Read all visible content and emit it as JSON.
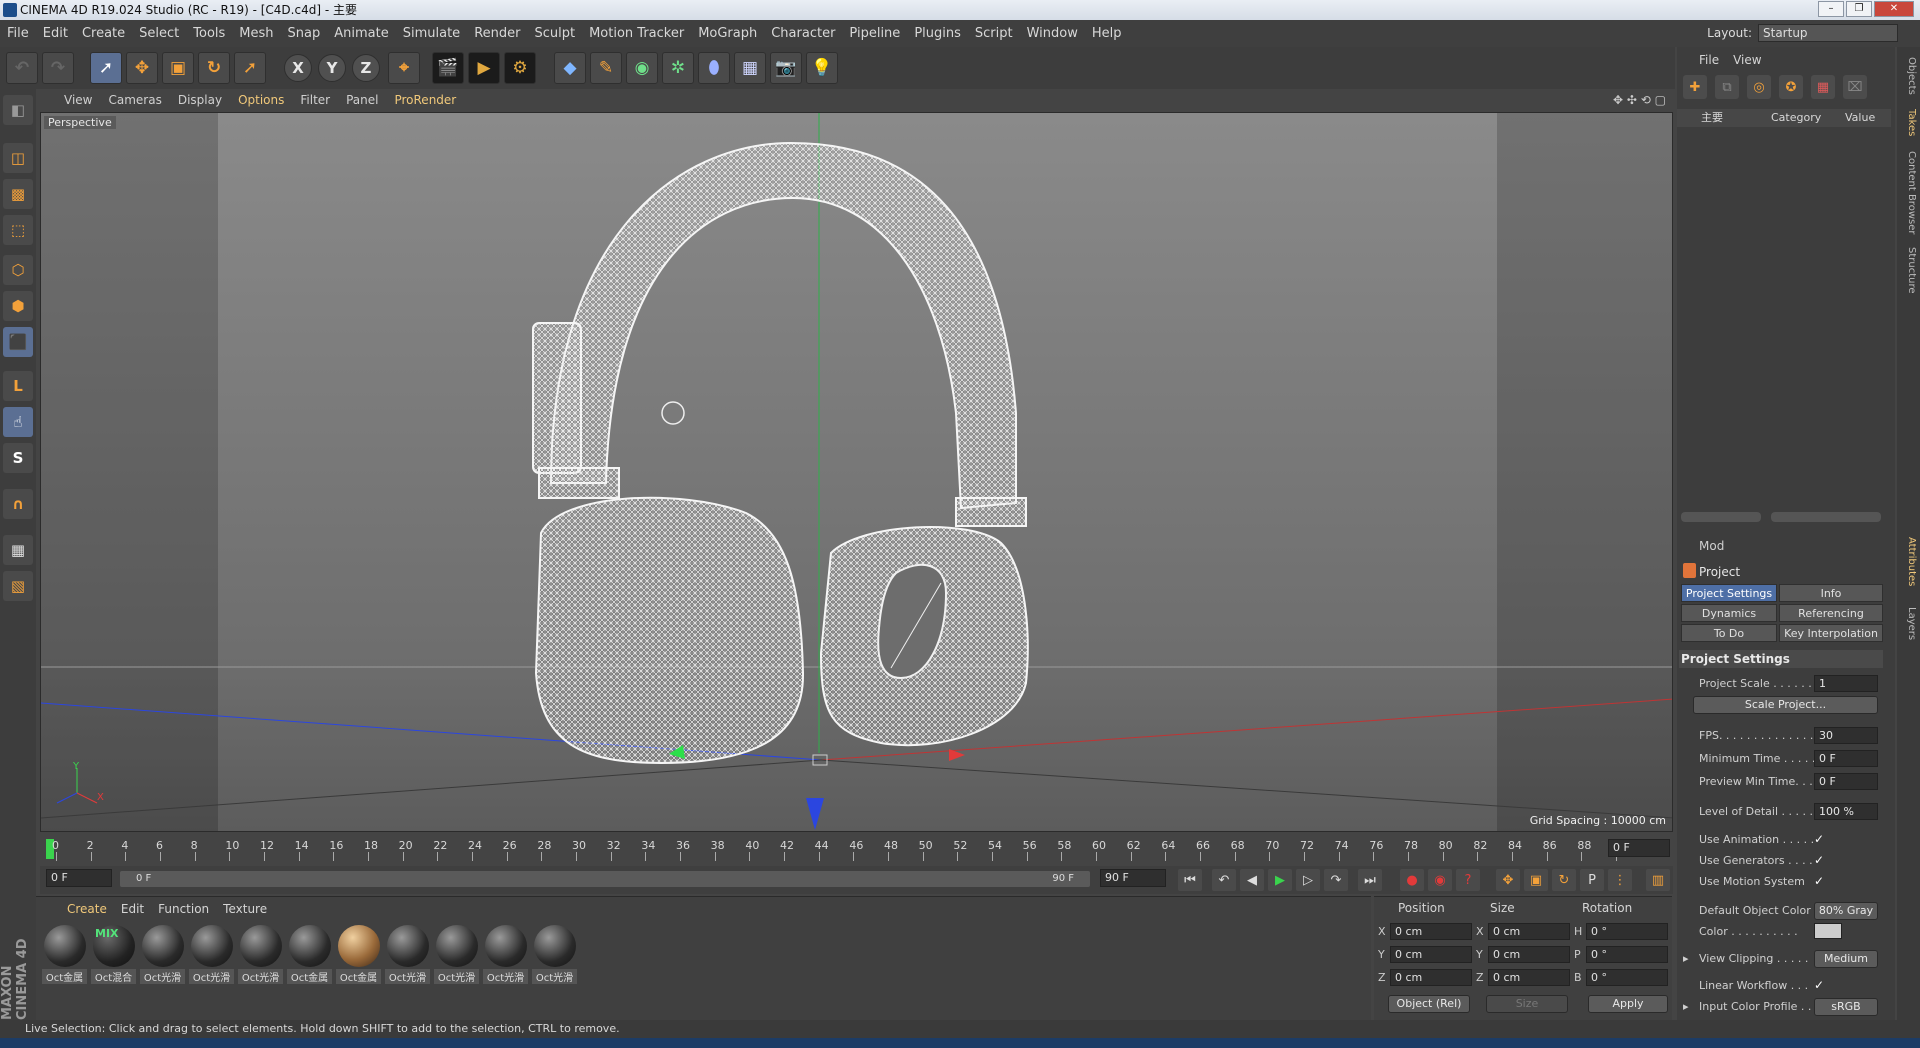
{
  "window": {
    "title": "CINEMA 4D R19.024 Studio (RC - R19) - [C4D.c4d] - 主要",
    "buttons": [
      "–",
      "❐",
      "✕"
    ]
  },
  "menubar": {
    "items": [
      "File",
      "Edit",
      "Create",
      "Select",
      "Tools",
      "Mesh",
      "Snap",
      "Animate",
      "Simulate",
      "Render",
      "Sculpt",
      "Motion Tracker",
      "MoGraph",
      "Character",
      "Pipeline",
      "Plugins",
      "Script",
      "Window",
      "Help"
    ],
    "layout_label": "Layout:",
    "layout_value": "Startup"
  },
  "viewport": {
    "menu": [
      "View",
      "Cameras",
      "Display",
      "Options",
      "Filter",
      "Panel",
      "ProRender"
    ],
    "label": "Perspective",
    "grid_spacing": "Grid Spacing : 10000 cm",
    "axis_y": "Y",
    "axis_x": "X"
  },
  "timeline": {
    "ticks": [
      "0",
      "2",
      "4",
      "6",
      "8",
      "10",
      "12",
      "14",
      "16",
      "18",
      "20",
      "22",
      "24",
      "26",
      "28",
      "30",
      "32",
      "34",
      "36",
      "38",
      "40",
      "42",
      "44",
      "46",
      "48",
      "50",
      "52",
      "54",
      "56",
      "58",
      "60",
      "62",
      "64",
      "66",
      "68",
      "70",
      "72",
      "74",
      "76",
      "78",
      "80",
      "82",
      "84",
      "86",
      "88",
      "90"
    ],
    "current_frame": "0 F",
    "start_field": "0 F",
    "range_start": "0 F",
    "range_end": "90 F",
    "end_field": "90 F"
  },
  "materials": {
    "menu": [
      "Create",
      "Edit",
      "Function",
      "Texture"
    ],
    "items": [
      {
        "label": "Oct金属",
        "style": "dark"
      },
      {
        "label": "Oct混合",
        "style": "mix",
        "tag": "MIX"
      },
      {
        "label": "Oct光滑",
        "style": "dark"
      },
      {
        "label": "Oct光滑",
        "style": "dark"
      },
      {
        "label": "Oct光滑",
        "style": "dark"
      },
      {
        "label": "Oct金属",
        "style": "dark"
      },
      {
        "label": "Oct金属",
        "style": "copper"
      },
      {
        "label": "Oct光滑",
        "style": "dark"
      },
      {
        "label": "Oct光滑",
        "style": "dark"
      },
      {
        "label": "Oct光滑",
        "style": "dark"
      },
      {
        "label": "Oct光滑",
        "style": "dark"
      }
    ]
  },
  "coordinates": {
    "headers": [
      "Position",
      "Size",
      "Rotation"
    ],
    "rows": [
      {
        "axis": "X",
        "pos": "0 cm",
        "size_axis": "X",
        "size": "0 cm",
        "rot_axis": "H",
        "rot": "0 °"
      },
      {
        "axis": "Y",
        "pos": "0 cm",
        "size_axis": "Y",
        "size": "0 cm",
        "rot_axis": "P",
        "rot": "0 °"
      },
      {
        "axis": "Z",
        "pos": "0 cm",
        "size_axis": "Z",
        "size": "0 cm",
        "rot_axis": "B",
        "rot": "0 °"
      }
    ],
    "mode_select": "Object (Rel)",
    "size_select": "Size",
    "apply": "Apply"
  },
  "status_bar": "Live Selection: Click and drag to select elements. Hold down SHIFT to add to the selection, CTRL to remove.",
  "brand": "MAXON CINEMA 4D",
  "object_manager": {
    "menu": [
      "File",
      "View"
    ],
    "tree_item": "主要",
    "columns": [
      "Category",
      "Value"
    ]
  },
  "attributes": {
    "mode_label": "Mod",
    "title": "Project",
    "tabs": [
      "Project Settings",
      "Info",
      "Dynamics",
      "Referencing",
      "To Do",
      "Key Interpolation"
    ],
    "section": "Project Settings",
    "props": [
      {
        "label": "Project Scale . . . . . .",
        "value": "1"
      },
      {
        "label": "FPS. . . . . . . . . . . . . .",
        "value": "30"
      },
      {
        "label": "Minimum Time . . . . .",
        "value": "0 F"
      },
      {
        "label": "Preview Min Time. . .",
        "value": "0 F"
      },
      {
        "label": "Level of Detail . . . . .",
        "value": "100 %"
      }
    ],
    "scale_button": "Scale Project...",
    "checks": [
      {
        "label": "Use Animation . . . . .",
        "mark": "✓"
      },
      {
        "label": "Use Generators . . . .",
        "mark": "✓"
      },
      {
        "label": "Use Motion System",
        "mark": "✓"
      }
    ],
    "default_color_label": "Default Object Color",
    "default_color_value": "80% Gray",
    "color_label": "Color . . . . . . . . . .",
    "view_clipping_label": "View Clipping . . . . .",
    "view_clipping_value": "Medium",
    "linear_workflow_label": "Linear Workflow . . .",
    "linear_workflow_mark": "✓",
    "input_profile_label": "Input Color Profile . .",
    "input_profile_value": "sRGB"
  },
  "side_tabs": [
    "Objects",
    "Takes",
    "Content Browser",
    "Structure",
    "Attributes",
    "Layers"
  ],
  "colors": {
    "accent": "#f0c87a",
    "x_axis": "#e23a3a",
    "y_axis": "#3ad34d",
    "z_axis": "#2b46e0",
    "selected_tab": "#4e6fa6"
  }
}
